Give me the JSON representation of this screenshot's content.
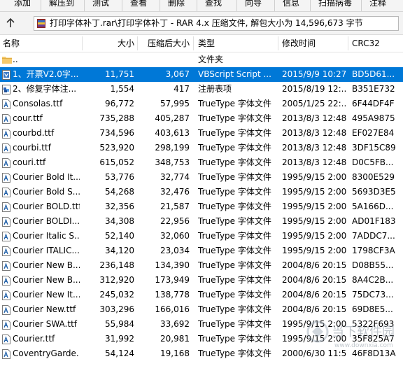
{
  "toolbar": {
    "buttons": [
      "添加",
      "解压到",
      "测试",
      "查看",
      "删除",
      "查找",
      "向导",
      "信息",
      "扫描病毒",
      "注释"
    ]
  },
  "pathbar": {
    "path": "打印字体补丁.rar\\打印字体补丁 - RAR 4.x 压缩文件, 解包大小为 14,596,673 字节"
  },
  "columns": {
    "name": "名称",
    "size": "大小",
    "packed": "压缩后大小",
    "type": "类型",
    "modified": "修改时间",
    "crc": "CRC32"
  },
  "files": [
    {
      "name": "..",
      "size": "",
      "packed": "",
      "type": "文件夹",
      "modified": "",
      "crc": "",
      "icon": "folder-icon"
    },
    {
      "name": "1、开票V2.0字...",
      "size": "11,751",
      "packed": "3,067",
      "type": "VBScript Script ...",
      "modified": "2015/9/9 10:27",
      "crc": "BD5D61...",
      "icon": "vbscript-file-icon"
    },
    {
      "name": "2、修复字体注...",
      "size": "1,554",
      "packed": "417",
      "type": "注册表项",
      "modified": "2015/8/19 12:...",
      "crc": "B351E732",
      "icon": "registry-file-icon"
    },
    {
      "name": "Consolas.ttf",
      "size": "96,772",
      "packed": "57,995",
      "type": "TrueType 字体文件",
      "modified": "2005/1/25 22:...",
      "crc": "6F44DF4F",
      "icon": "font-file-icon"
    },
    {
      "name": "cour.ttf",
      "size": "735,288",
      "packed": "405,287",
      "type": "TrueType 字体文件",
      "modified": "2013/8/3 12:48",
      "crc": "495A9875",
      "icon": "font-file-icon"
    },
    {
      "name": "courbd.ttf",
      "size": "734,596",
      "packed": "403,613",
      "type": "TrueType 字体文件",
      "modified": "2013/8/3 12:48",
      "crc": "EF027E84",
      "icon": "font-file-icon"
    },
    {
      "name": "courbi.ttf",
      "size": "523,920",
      "packed": "298,199",
      "type": "TrueType 字体文件",
      "modified": "2013/8/3 12:48",
      "crc": "3DF15C89",
      "icon": "font-file-icon"
    },
    {
      "name": "couri.ttf",
      "size": "615,052",
      "packed": "348,753",
      "type": "TrueType 字体文件",
      "modified": "2013/8/3 12:48",
      "crc": "D0C5FB...",
      "icon": "font-file-icon"
    },
    {
      "name": "Courier Bold It...",
      "size": "53,776",
      "packed": "32,774",
      "type": "TrueType 字体文件",
      "modified": "1995/9/15 2:00",
      "crc": "8300E529",
      "icon": "font-file-icon"
    },
    {
      "name": "Courier Bold S...",
      "size": "54,268",
      "packed": "32,476",
      "type": "TrueType 字体文件",
      "modified": "1995/9/15 2:00",
      "crc": "5693D3E5",
      "icon": "font-file-icon"
    },
    {
      "name": "Courier BOLD.ttf",
      "size": "32,356",
      "packed": "21,587",
      "type": "TrueType 字体文件",
      "modified": "1995/9/15 2:00",
      "crc": "5A166D...",
      "icon": "font-file-icon"
    },
    {
      "name": "Courier BOLDI...",
      "size": "34,308",
      "packed": "22,956",
      "type": "TrueType 字体文件",
      "modified": "1995/9/15 2:00",
      "crc": "AD01F183",
      "icon": "font-file-icon"
    },
    {
      "name": "Courier Italic S...",
      "size": "52,140",
      "packed": "32,060",
      "type": "TrueType 字体文件",
      "modified": "1995/9/15 2:00",
      "crc": "7ADDC7...",
      "icon": "font-file-icon"
    },
    {
      "name": "Courier ITALIC...",
      "size": "34,120",
      "packed": "23,034",
      "type": "TrueType 字体文件",
      "modified": "1995/9/15 2:00",
      "crc": "1798CF3A",
      "icon": "font-file-icon"
    },
    {
      "name": "Courier New B...",
      "size": "236,148",
      "packed": "134,390",
      "type": "TrueType 字体文件",
      "modified": "2004/8/6 20:15",
      "crc": "D08B55...",
      "icon": "font-file-icon"
    },
    {
      "name": "Courier New B...",
      "size": "312,920",
      "packed": "173,949",
      "type": "TrueType 字体文件",
      "modified": "2004/8/6 20:15",
      "crc": "8A4C2B...",
      "icon": "font-file-icon"
    },
    {
      "name": "Courier New It...",
      "size": "245,032",
      "packed": "138,778",
      "type": "TrueType 字体文件",
      "modified": "2004/8/6 20:15",
      "crc": "75DC73...",
      "icon": "font-file-icon"
    },
    {
      "name": "Courier New.ttf",
      "size": "303,296",
      "packed": "166,016",
      "type": "TrueType 字体文件",
      "modified": "2004/8/6 20:15",
      "crc": "69D8E5...",
      "icon": "font-file-icon"
    },
    {
      "name": "Courier SWA.ttf",
      "size": "55,984",
      "packed": "33,692",
      "type": "TrueType 字体文件",
      "modified": "1995/9/15 2:00",
      "crc": "5322F693",
      "icon": "font-file-icon"
    },
    {
      "name": "Courier.ttf",
      "size": "31,992",
      "packed": "20,981",
      "type": "TrueType 字体文件",
      "modified": "1995/9/15 2:00",
      "crc": "35F825A7",
      "icon": "font-file-icon"
    },
    {
      "name": "CoventryGarde...",
      "size": "54,124",
      "packed": "19,168",
      "type": "TrueType 字体文件",
      "modified": "2000/6/30 11:5...",
      "crc": "46F8D13A",
      "icon": "font-file-icon"
    }
  ],
  "selected_index": 1,
  "colors": {
    "selection": "#0078d7",
    "font_icon": "#1f5fa8",
    "folder": "#f5c96b"
  },
  "watermark": {
    "text": "当下软件园",
    "url": "www.downxia.com"
  }
}
